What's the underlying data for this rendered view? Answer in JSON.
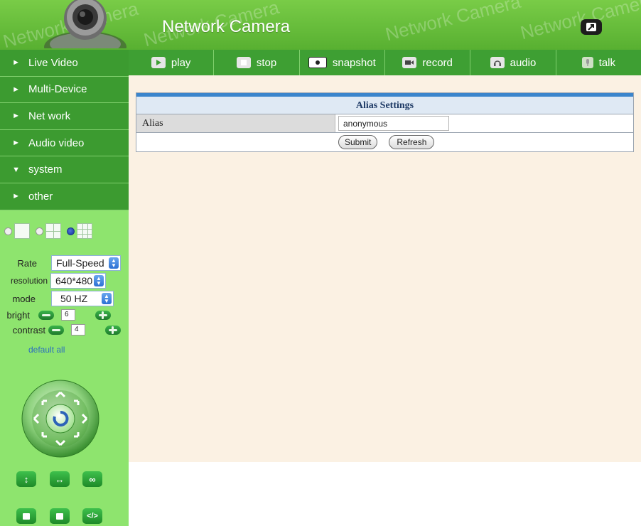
{
  "header": {
    "title": "Network Camera",
    "watermark": "Network Camera",
    "fullscreen_icon": "fullscreen-icon"
  },
  "sidebar": {
    "items": [
      {
        "label": "Live Video",
        "arrow": "►"
      },
      {
        "label": "Multi-Device",
        "arrow": "►"
      },
      {
        "label": "Net work",
        "arrow": "►"
      },
      {
        "label": "Audio video",
        "arrow": "►"
      },
      {
        "label": "system",
        "arrow": "▼"
      },
      {
        "label": "other",
        "arrow": "►"
      }
    ]
  },
  "toolbar": {
    "items": [
      {
        "label": "play",
        "icon": "play-icon"
      },
      {
        "label": "stop",
        "icon": "stop-icon"
      },
      {
        "label": "snapshot",
        "icon": "snapshot-icon"
      },
      {
        "label": "record",
        "icon": "record-icon"
      },
      {
        "label": "audio",
        "icon": "audio-icon"
      },
      {
        "label": "talk",
        "icon": "talk-icon"
      }
    ]
  },
  "controls": {
    "rate": {
      "label": "Rate",
      "value": "Full-Speed"
    },
    "resolution": {
      "label": "resolution",
      "value": "640*480"
    },
    "mode": {
      "label": "mode",
      "value": "50 HZ"
    },
    "bright": {
      "label": "bright",
      "value": "6"
    },
    "contrast": {
      "label": "contrast",
      "value": "4"
    },
    "default_all": "default all",
    "layout_selected_index": 3
  },
  "main": {
    "panel_title": "Alias Settings",
    "alias_label": "Alias",
    "alias_value": "anonymous",
    "submit_label": "Submit",
    "refresh_label": "Refresh"
  },
  "colors": {
    "header_green": "#58b031",
    "nav_green": "#3c9b30",
    "panel_green": "#8ee46e",
    "content_bg": "#fbf1e3",
    "table_header_blue": "#3b85cc"
  }
}
